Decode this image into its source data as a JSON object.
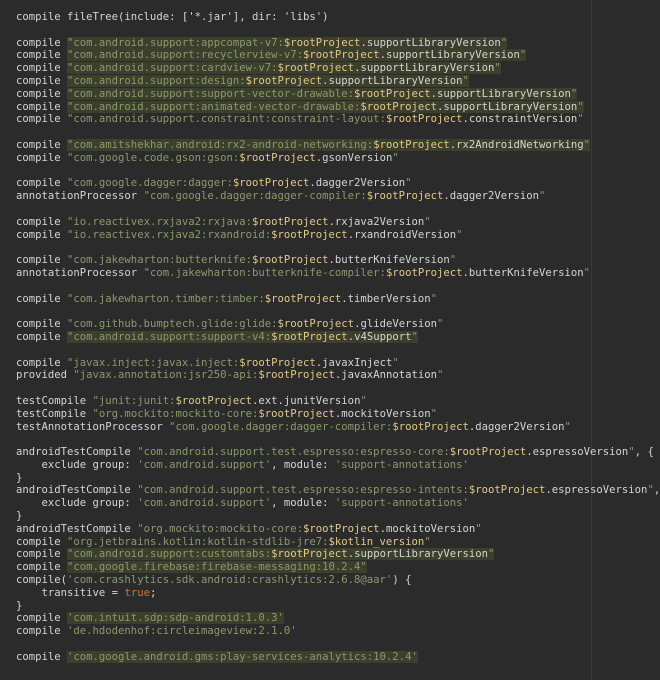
{
  "colors": {
    "background": "#2b2b2b",
    "text": "#d4d4d4",
    "string": "#8a9a6c",
    "string_highlight_bg": "#3d3f2d",
    "variable": "#e2c98a",
    "keyword": "#cc7832"
  },
  "lines": [
    [
      {
        "c": "k",
        "t": "compile fileTree(include: ['*.jar'], dir: 'libs')"
      }
    ],
    [],
    [
      {
        "c": "k",
        "t": "compile "
      },
      {
        "c": "s hl",
        "t": "\"com.android.support:appcompat-v7:"
      },
      {
        "c": "v hl",
        "t": "$rootProject"
      },
      {
        "c": "p hl",
        "t": ".supportLibraryVersion"
      },
      {
        "c": "s hl",
        "t": "\""
      }
    ],
    [
      {
        "c": "k",
        "t": "compile "
      },
      {
        "c": "s hl",
        "t": "\"com.android.support:recyclerview-v7:"
      },
      {
        "c": "v hl",
        "t": "$rootProject"
      },
      {
        "c": "p hl",
        "t": ".supportLibraryVersion"
      },
      {
        "c": "s hl",
        "t": "\""
      }
    ],
    [
      {
        "c": "k",
        "t": "compile "
      },
      {
        "c": "s hl",
        "t": "\"com.android.support:cardview-v7:"
      },
      {
        "c": "v hl",
        "t": "$rootProject"
      },
      {
        "c": "p hl",
        "t": ".supportLibraryVersion"
      },
      {
        "c": "s hl",
        "t": "\""
      }
    ],
    [
      {
        "c": "k",
        "t": "compile "
      },
      {
        "c": "s hl",
        "t": "\"com.android.support:design:"
      },
      {
        "c": "v hl",
        "t": "$rootProject"
      },
      {
        "c": "p hl",
        "t": ".supportLibraryVersion"
      },
      {
        "c": "s hl",
        "t": "\""
      }
    ],
    [
      {
        "c": "k",
        "t": "compile "
      },
      {
        "c": "s hl",
        "t": "\"com.android.support:support-vector-drawable:"
      },
      {
        "c": "v hl",
        "t": "$rootProject"
      },
      {
        "c": "p hl",
        "t": ".supportLibraryVersion"
      },
      {
        "c": "s hl",
        "t": "\""
      }
    ],
    [
      {
        "c": "k",
        "t": "compile "
      },
      {
        "c": "s hl",
        "t": "\"com.android.support:animated-vector-drawable:"
      },
      {
        "c": "v hl",
        "t": "$rootProject"
      },
      {
        "c": "p hl",
        "t": ".supportLibraryVersion"
      },
      {
        "c": "s hl",
        "t": "\""
      }
    ],
    [
      {
        "c": "k",
        "t": "compile "
      },
      {
        "c": "s",
        "t": "\"com.android.support.constraint:constraint-layout:"
      },
      {
        "c": "v",
        "t": "$rootProject"
      },
      {
        "c": "p",
        "t": ".constraintVersion"
      },
      {
        "c": "s",
        "t": "\""
      }
    ],
    [],
    [
      {
        "c": "k",
        "t": "compile "
      },
      {
        "c": "s hl",
        "t": "\"com.amitshekhar.android:rx2-android-networking:"
      },
      {
        "c": "v hl",
        "t": "$rootProject"
      },
      {
        "c": "p hl",
        "t": ".rx2AndroidNetworking"
      },
      {
        "c": "s hl",
        "t": "\""
      }
    ],
    [
      {
        "c": "k",
        "t": "compile "
      },
      {
        "c": "s",
        "t": "\"com.google.code.gson:gson:"
      },
      {
        "c": "v",
        "t": "$rootProject"
      },
      {
        "c": "p",
        "t": ".gsonVersion"
      },
      {
        "c": "s",
        "t": "\""
      }
    ],
    [],
    [
      {
        "c": "k",
        "t": "compile "
      },
      {
        "c": "s",
        "t": "\"com.google.dagger:dagger:"
      },
      {
        "c": "v",
        "t": "$rootProject"
      },
      {
        "c": "p",
        "t": ".dagger2Version"
      },
      {
        "c": "s",
        "t": "\""
      }
    ],
    [
      {
        "c": "k",
        "t": "annotationProcessor "
      },
      {
        "c": "s",
        "t": "\"com.google.dagger:dagger-compiler:"
      },
      {
        "c": "v",
        "t": "$rootProject"
      },
      {
        "c": "p",
        "t": ".dagger2Version"
      },
      {
        "c": "s",
        "t": "\""
      }
    ],
    [],
    [
      {
        "c": "k",
        "t": "compile "
      },
      {
        "c": "s",
        "t": "\"io.reactivex.rxjava2:rxjava:"
      },
      {
        "c": "v",
        "t": "$rootProject"
      },
      {
        "c": "p",
        "t": ".rxjava2Version"
      },
      {
        "c": "s",
        "t": "\""
      }
    ],
    [
      {
        "c": "k",
        "t": "compile "
      },
      {
        "c": "s",
        "t": "\"io.reactivex.rxjava2:rxandroid:"
      },
      {
        "c": "v",
        "t": "$rootProject"
      },
      {
        "c": "p",
        "t": ".rxandroidVersion"
      },
      {
        "c": "s",
        "t": "\""
      }
    ],
    [],
    [
      {
        "c": "k",
        "t": "compile "
      },
      {
        "c": "s",
        "t": "\"com.jakewharton:butterknife:"
      },
      {
        "c": "v",
        "t": "$rootProject"
      },
      {
        "c": "p",
        "t": ".butterKnifeVersion"
      },
      {
        "c": "s",
        "t": "\""
      }
    ],
    [
      {
        "c": "k",
        "t": "annotationProcessor "
      },
      {
        "c": "s",
        "t": "\"com.jakewharton:butterknife-compiler:"
      },
      {
        "c": "v",
        "t": "$rootProject"
      },
      {
        "c": "p",
        "t": ".butterKnifeVersion"
      },
      {
        "c": "s",
        "t": "\""
      }
    ],
    [],
    [
      {
        "c": "k",
        "t": "compile "
      },
      {
        "c": "s",
        "t": "\"com.jakewharton.timber:timber:"
      },
      {
        "c": "v",
        "t": "$rootProject"
      },
      {
        "c": "p",
        "t": ".timberVersion"
      },
      {
        "c": "s",
        "t": "\""
      }
    ],
    [],
    [
      {
        "c": "k",
        "t": "compile "
      },
      {
        "c": "s",
        "t": "\"com.github.bumptech.glide:glide:"
      },
      {
        "c": "v",
        "t": "$rootProject"
      },
      {
        "c": "p",
        "t": ".glideVersion"
      },
      {
        "c": "s",
        "t": "\""
      }
    ],
    [
      {
        "c": "k",
        "t": "compile "
      },
      {
        "c": "s hl",
        "t": "\"com.android.support:support-v4:"
      },
      {
        "c": "v hl",
        "t": "$rootProject"
      },
      {
        "c": "p hl",
        "t": ".v4Support"
      },
      {
        "c": "s hl",
        "t": "\""
      }
    ],
    [],
    [
      {
        "c": "k",
        "t": "compile "
      },
      {
        "c": "s",
        "t": "\"javax.inject:javax.inject:"
      },
      {
        "c": "v",
        "t": "$rootProject"
      },
      {
        "c": "p",
        "t": ".javaxInject"
      },
      {
        "c": "s",
        "t": "\""
      }
    ],
    [
      {
        "c": "k",
        "t": "provided "
      },
      {
        "c": "s",
        "t": "\"javax.annotation:jsr250-api:"
      },
      {
        "c": "v",
        "t": "$rootProject"
      },
      {
        "c": "p",
        "t": ".javaxAnnotation"
      },
      {
        "c": "s",
        "t": "\""
      }
    ],
    [],
    [
      {
        "c": "k",
        "t": "testCompile "
      },
      {
        "c": "s",
        "t": "\"junit:junit:"
      },
      {
        "c": "v",
        "t": "$rootProject"
      },
      {
        "c": "p",
        "t": ".ext.junitVersion"
      },
      {
        "c": "s",
        "t": "\""
      }
    ],
    [
      {
        "c": "k",
        "t": "testCompile "
      },
      {
        "c": "s",
        "t": "\"org.mockito:mockito-core:"
      },
      {
        "c": "v",
        "t": "$rootProject"
      },
      {
        "c": "p",
        "t": ".mockitoVersion"
      },
      {
        "c": "s",
        "t": "\""
      }
    ],
    [
      {
        "c": "k",
        "t": "testAnnotationProcessor "
      },
      {
        "c": "s",
        "t": "\"com.google.dagger:dagger-compiler:"
      },
      {
        "c": "v",
        "t": "$rootProject"
      },
      {
        "c": "p",
        "t": ".dagger2Version"
      },
      {
        "c": "s",
        "t": "\""
      }
    ],
    [],
    [
      {
        "c": "k",
        "t": "androidTestCompile "
      },
      {
        "c": "s",
        "t": "\"com.android.support.test.espresso:espresso-core:"
      },
      {
        "c": "v",
        "t": "$rootProject"
      },
      {
        "c": "p",
        "t": ".espressoVersion"
      },
      {
        "c": "s",
        "t": "\""
      },
      {
        "c": "k",
        "t": ", {"
      }
    ],
    [
      {
        "c": "k",
        "t": "    exclude group: "
      },
      {
        "c": "s",
        "t": "'com.android.support'"
      },
      {
        "c": "k",
        "t": ", module: "
      },
      {
        "c": "s",
        "t": "'support-annotations'"
      }
    ],
    [
      {
        "c": "k",
        "t": "}"
      }
    ],
    [
      {
        "c": "k",
        "t": "androidTestCompile "
      },
      {
        "c": "s",
        "t": "\"com.android.support.test.espresso:espresso-intents:"
      },
      {
        "c": "v",
        "t": "$rootProject"
      },
      {
        "c": "p",
        "t": ".espressoVersion"
      },
      {
        "c": "s",
        "t": "\""
      },
      {
        "c": "k",
        "t": ", {"
      }
    ],
    [
      {
        "c": "k",
        "t": "    exclude group: "
      },
      {
        "c": "s",
        "t": "'com.android.support'"
      },
      {
        "c": "k",
        "t": ", module: "
      },
      {
        "c": "s",
        "t": "'support-annotations'"
      }
    ],
    [
      {
        "c": "k",
        "t": "}"
      }
    ],
    [
      {
        "c": "k",
        "t": "androidTestCompile "
      },
      {
        "c": "s",
        "t": "\"org.mockito:mockito-core:"
      },
      {
        "c": "v",
        "t": "$rootProject"
      },
      {
        "c": "p",
        "t": ".mockitoVersion"
      },
      {
        "c": "s",
        "t": "\""
      }
    ],
    [
      {
        "c": "k",
        "t": "compile "
      },
      {
        "c": "s",
        "t": "\"org.jetbrains.kotlin:kotlin-stdlib-jre7:"
      },
      {
        "c": "v",
        "t": "$kotlin_version"
      },
      {
        "c": "s",
        "t": "\""
      }
    ],
    [
      {
        "c": "k",
        "t": "compile "
      },
      {
        "c": "s hl",
        "t": "\"com.android.support:customtabs:"
      },
      {
        "c": "v hl",
        "t": "$rootProject"
      },
      {
        "c": "p hl",
        "t": ".supportLibraryVersion"
      },
      {
        "c": "s hl",
        "t": "\""
      }
    ],
    [
      {
        "c": "k",
        "t": "compile "
      },
      {
        "c": "s hl",
        "t": "\"com.google.firebase:firebase-messaging:10.2.4\""
      }
    ],
    [
      {
        "c": "k",
        "t": "compile("
      },
      {
        "c": "s",
        "t": "'com.crashlytics.sdk.android:crashlytics:2.6.8@aar'"
      },
      {
        "c": "k",
        "t": ") {"
      }
    ],
    [
      {
        "c": "k",
        "t": "    transitive = "
      },
      {
        "c": "kw",
        "t": "true"
      },
      {
        "c": "k",
        "t": ";"
      }
    ],
    [
      {
        "c": "k",
        "t": "}"
      }
    ],
    [
      {
        "c": "k",
        "t": "compile "
      },
      {
        "c": "s hl",
        "t": "'com.intuit.sdp:sdp-android:1.0.3'"
      }
    ],
    [
      {
        "c": "k",
        "t": "compile "
      },
      {
        "c": "s",
        "t": "'de.hdodenhof:circleimageview:2.1.0'"
      }
    ],
    [],
    [
      {
        "c": "k",
        "t": "compile "
      },
      {
        "c": "s hl",
        "t": "'com.google.android.gms:play-services-analytics:10.2.4'"
      }
    ]
  ]
}
